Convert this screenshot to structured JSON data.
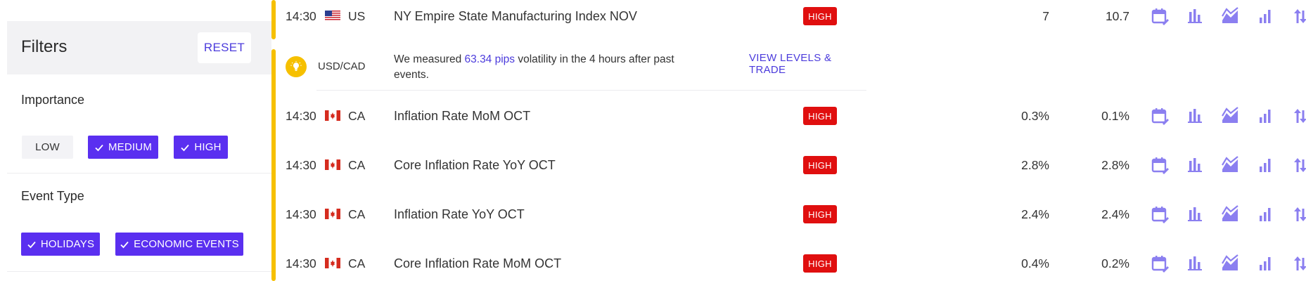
{
  "filters": {
    "title": "Filters",
    "reset_label": "RESET",
    "importance": {
      "title": "Importance",
      "options": [
        {
          "label": "LOW",
          "selected": false
        },
        {
          "label": "MEDIUM",
          "selected": true
        },
        {
          "label": "HIGH",
          "selected": true
        }
      ]
    },
    "event_type": {
      "title": "Event Type",
      "options": [
        {
          "label": "HOLIDAYS",
          "selected": true
        },
        {
          "label": "ECONOMIC EVENTS",
          "selected": true
        }
      ]
    }
  },
  "colors": {
    "accent": "#f6c000",
    "brand": "#5a2ff0",
    "link": "#4b3bdc",
    "high_badge": "#e00f0f",
    "icon": "#8b7ff0"
  },
  "events": [
    {
      "time": "14:30",
      "flag": "us-flag",
      "currency": "US",
      "name": "NY Empire State Manufacturing Index NOV",
      "importance": "HIGH",
      "actual": "7",
      "forecast": "10.7"
    },
    {
      "time": "14:30",
      "flag": "ca-flag",
      "currency": "CA",
      "name": "Inflation Rate MoM OCT",
      "importance": "HIGH",
      "actual": "0.3%",
      "forecast": "0.1%"
    },
    {
      "time": "14:30",
      "flag": "ca-flag",
      "currency": "CA",
      "name": "Core Inflation Rate YoY OCT",
      "importance": "HIGH",
      "actual": "2.8%",
      "forecast": "2.8%"
    },
    {
      "time": "14:30",
      "flag": "ca-flag",
      "currency": "CA",
      "name": "Inflation Rate YoY OCT",
      "importance": "HIGH",
      "actual": "2.4%",
      "forecast": "2.4%"
    },
    {
      "time": "14:30",
      "flag": "ca-flag",
      "currency": "CA",
      "name": "Core Inflation Rate MoM OCT",
      "importance": "HIGH",
      "actual": "0.4%",
      "forecast": "0.2%"
    }
  ],
  "insight": {
    "icon": "lightbulb-icon",
    "pair": "USD/CAD",
    "text_before": "We measured",
    "pips": "63.34 pips",
    "text_after": "volatility in the 4 hours after past events.",
    "link_label": "VIEW LEVELS & TRADE"
  },
  "row_icons": [
    "calendar-edit-icon",
    "bar-chart-icon",
    "area-chart-icon",
    "signal-bars-icon",
    "sort-arrows-icon"
  ]
}
